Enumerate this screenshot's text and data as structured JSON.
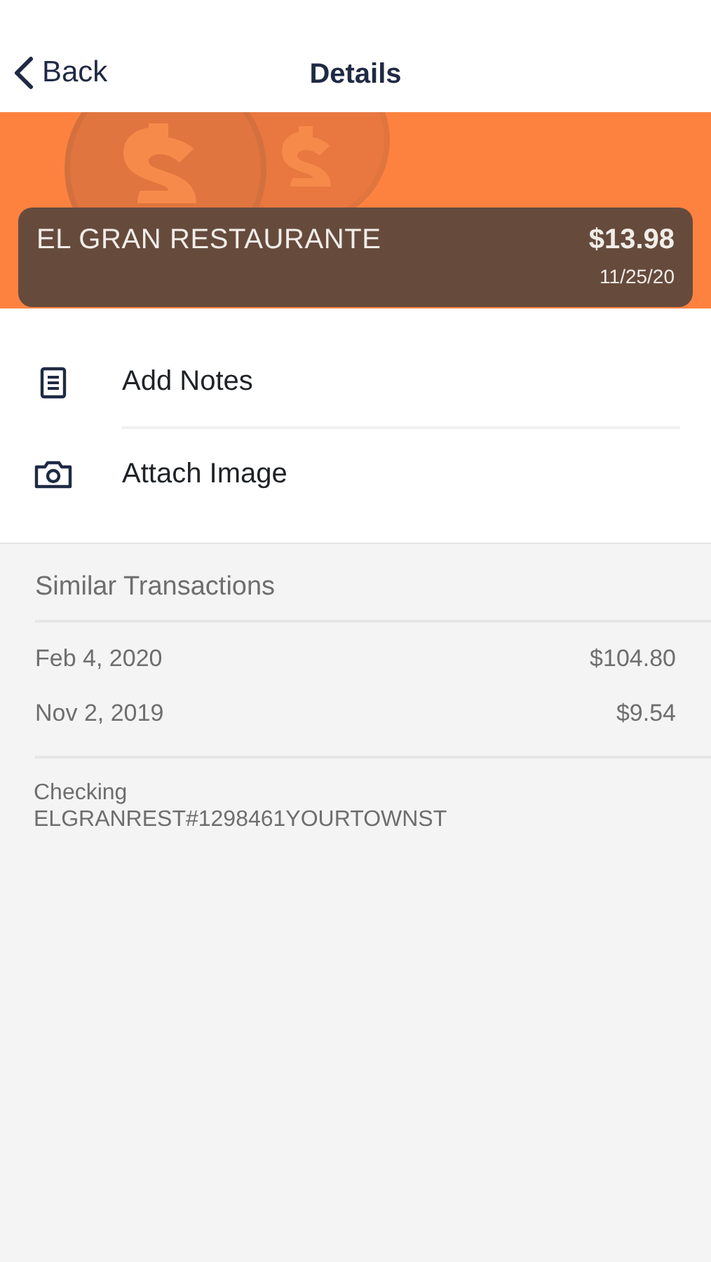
{
  "nav": {
    "back": "Back",
    "title": "Details"
  },
  "transaction": {
    "merchant": "EL GRAN RESTAURANTE",
    "amount": "$13.98",
    "date": "11/25/20"
  },
  "actions": [
    {
      "kind": "notes",
      "label": "Add Notes"
    },
    {
      "kind": "camera",
      "label": "Attach Image"
    }
  ],
  "similar": {
    "heading": "Similar Transactions",
    "rows": [
      {
        "date": "Feb 4, 2020",
        "amount": "$104.80"
      },
      {
        "date": "Nov 2, 2019",
        "amount": "$9.54"
      }
    ]
  },
  "account": {
    "type": "Checking",
    "description": "ELGRANREST#1298461YOURTOWNST"
  }
}
